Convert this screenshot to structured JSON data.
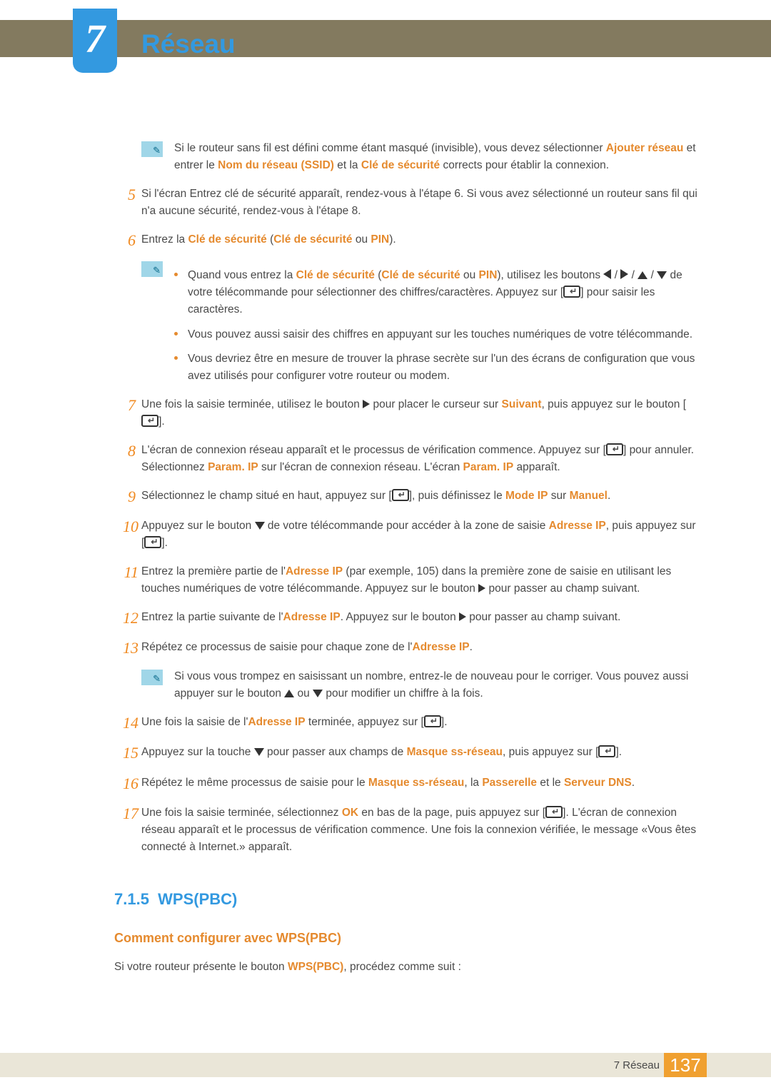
{
  "chapter": {
    "number": "7",
    "title": "Réseau"
  },
  "intro_note": {
    "p1a": "Si le routeur sans fil est défini comme étant masqué (invisible), vous devez sélectionner ",
    "k1": "Ajouter réseau",
    "p1b": " et entrer le ",
    "k2": "Nom du réseau (SSID)",
    "p1c": " et la ",
    "k3": "Clé de sécurité",
    "p1d": " corrects pour établir la connexion."
  },
  "s5": {
    "n": "5",
    "t": "Si l'écran Entrez clé de sécurité apparaît, rendez-vous à l'étape 6. Si vous avez sélectionné un routeur sans fil qui n'a aucune sécurité, rendez-vous à l'étape 8."
  },
  "s6": {
    "n": "6",
    "a": "Entrez la ",
    "k1": "Clé de sécurité",
    "b": " (",
    "k2": "Clé de sécurité",
    "c": " ou ",
    "k3": "PIN",
    "d": ")."
  },
  "s6n": {
    "b1a": "Quand vous entrez la ",
    "b1k1": "Clé de sécurité",
    "b1b": " (",
    "b1k2": "Clé de sécurité",
    "b1c": " ou ",
    "b1k3": "PIN",
    "b1d": "), utilisez les boutons ",
    "b1e": " de votre télécommande pour sélectionner des chiffres/caractères. Appuyez sur [",
    "b1f": "] pour saisir les caractères.",
    "b2": "Vous pouvez aussi saisir des chiffres en appuyant sur les touches numériques de votre télécommande.",
    "b3": "Vous devriez être en mesure de trouver la phrase secrète sur l'un des écrans de configuration que vous avez utilisés pour configurer votre routeur ou modem."
  },
  "s7": {
    "n": "7",
    "a": "Une fois la saisie terminée, utilisez le bouton ",
    "b": " pour placer le curseur sur ",
    "k1": "Suivant",
    "c": ", puis appuyez sur le bouton [",
    "d": "]."
  },
  "s8": {
    "n": "8",
    "a": "L'écran de connexion réseau apparaît et le processus de vérification commence. Appuyez sur [",
    "b": "] pour annuler. Sélectionnez ",
    "k1": "Param. IP",
    "c": " sur l'écran de connexion réseau. L'écran ",
    "k2": "Param. IP",
    "d": " apparaît."
  },
  "s9": {
    "n": "9",
    "a": "Sélectionnez le champ situé en haut, appuyez sur [",
    "b": "], puis définissez le ",
    "k1": "Mode IP",
    "c": " sur ",
    "k2": "Manuel",
    "d": "."
  },
  "s10": {
    "n": "10",
    "a": "Appuyez sur le bouton ",
    "b": " de votre télécommande pour accéder à la zone de saisie ",
    "k1": "Adresse IP",
    "c": ", puis appuyez sur [",
    "d": "]."
  },
  "s11": {
    "n": "11",
    "a": "Entrez la première partie de l'",
    "k1": "Adresse IP",
    "b": " (par exemple, 105) dans la première zone de saisie en utilisant les touches numériques de votre télécommande. Appuyez sur le bouton ",
    "c": " pour passer au champ suivant."
  },
  "s12": {
    "n": "12",
    "a": "Entrez la partie suivante de l'",
    "k1": "Adresse IP",
    "b": ". Appuyez sur le bouton ",
    "c": " pour passer au champ suivant."
  },
  "s13": {
    "n": "13",
    "a": "Répétez ce processus de saisie pour chaque zone de l'",
    "k1": "Adresse IP",
    "b": "."
  },
  "s13n": {
    "a": "Si vous vous trompez en saisissant un nombre, entrez-le de nouveau pour le corriger. Vous pouvez aussi appuyer sur le bouton ",
    "b": " ou ",
    "c": " pour modifier un chiffre à la fois."
  },
  "s14": {
    "n": "14",
    "a": "Une fois la saisie de l'",
    "k1": "Adresse IP",
    "b": " terminée, appuyez sur [",
    "c": "]."
  },
  "s15": {
    "n": "15",
    "a": "Appuyez sur la touche ",
    "b": " pour passer aux champs de ",
    "k1": "Masque ss-réseau",
    "c": ", puis appuyez sur [",
    "d": "]."
  },
  "s16": {
    "n": "16",
    "a": "Répétez le même processus de saisie pour le ",
    "k1": "Masque ss-réseau",
    "b": ", la ",
    "k2": "Passerelle",
    "c": " et le ",
    "k3": "Serveur DNS",
    "d": "."
  },
  "s17": {
    "n": "17",
    "a": "Une fois la saisie terminée, sélectionnez ",
    "k1": "OK",
    "b": " en bas de la page, puis appuyez sur [",
    "c": "]. L'écran de connexion réseau apparaît et le processus de vérification commence. Une fois la connexion vérifiée, le message «Vous êtes connecté à Internet.» apparaît."
  },
  "sec715": {
    "num": "7.1.5",
    "title": "WPS(PBC)"
  },
  "sub": {
    "title": "Comment configurer avec WPS(PBC)"
  },
  "wps_intro": {
    "a": "Si votre routeur présente le bouton ",
    "k1": "WPS(PBC)",
    "b": ", procédez comme suit :"
  },
  "footer": {
    "label": "7 Réseau",
    "page": "137"
  }
}
